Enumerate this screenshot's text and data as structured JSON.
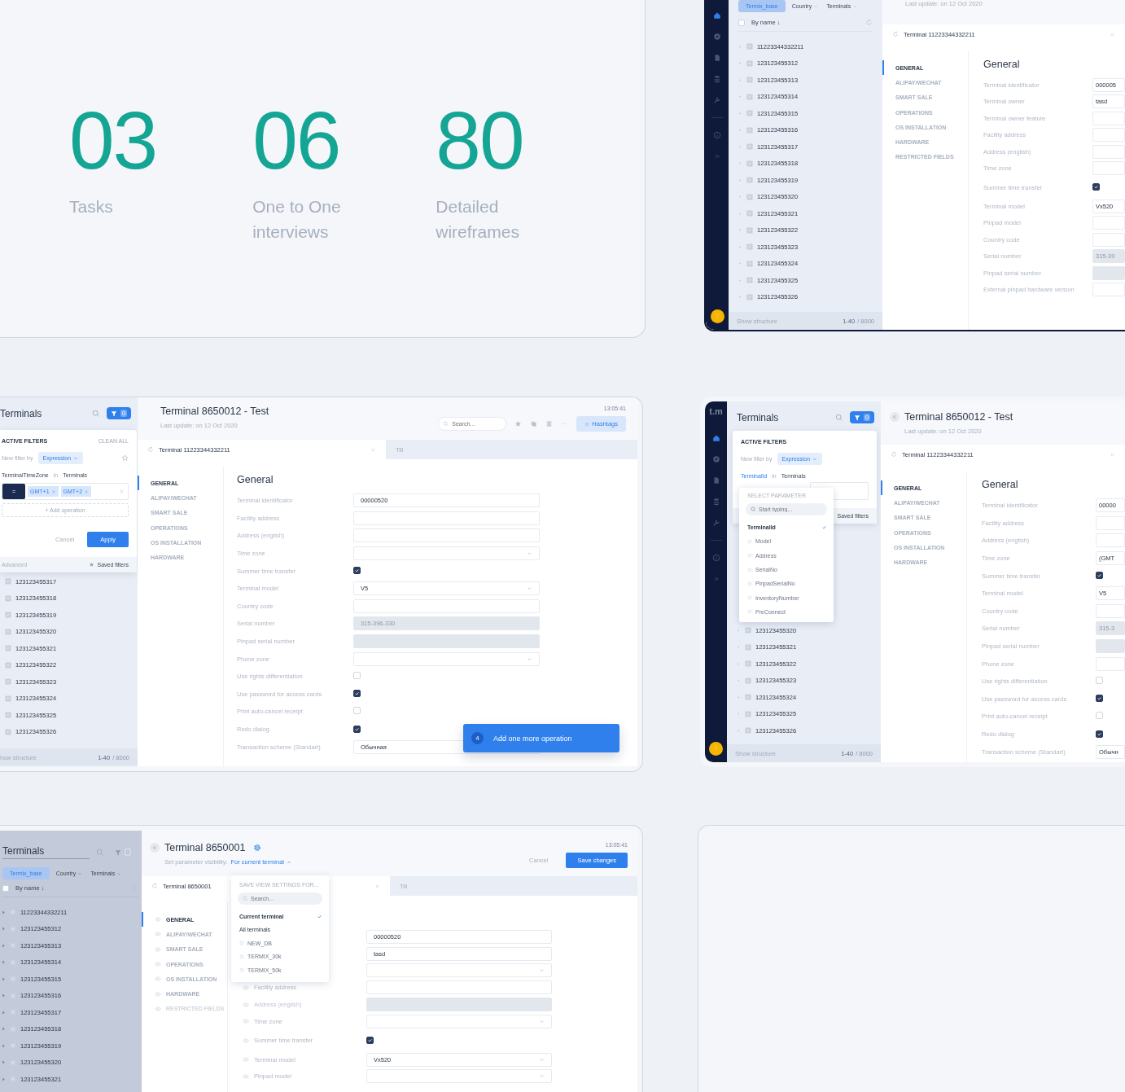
{
  "stats": [
    {
      "value": "03",
      "label": "Tasks"
    },
    {
      "value": "06",
      "label": "One to One interviews"
    },
    {
      "value": "80",
      "label": "Detailed wireframes"
    }
  ],
  "screens": [
    {
      "rail": {
        "avatar": "T"
      },
      "list": {
        "tags": [
          {
            "label": "Termix_base",
            "selected": true
          },
          {
            "label": "Country",
            "selected": false
          },
          {
            "label": "Terminals",
            "selected": false
          }
        ],
        "sort": "By name ↓",
        "expandable": true,
        "dimmed": false,
        "items": [
          "11223344332211",
          "123123455312",
          "123123455313",
          "123123455314",
          "123123455315",
          "123123455316",
          "123123455317",
          "123123455318",
          "123123455319",
          "123123455320",
          "123123455321",
          "123123455322",
          "123123455323",
          "123123455324",
          "123123455325",
          "123123455326"
        ],
        "footer": {
          "link": "Show structure",
          "range": "1-40",
          "total": "/ 8000"
        }
      },
      "detail": {
        "updated": "Last update: on 12 Oct 2020",
        "tabs": [
          {
            "label": "Terminal 11223344332211",
            "selected": true
          }
        ],
        "nav": [
          {
            "label": "GENERAL",
            "selected": true,
            "disabled": false
          },
          {
            "label": "ALIPAY/WECHAT",
            "selected": false,
            "disabled": false
          },
          {
            "label": "SMART SALE",
            "selected": false,
            "disabled": false
          },
          {
            "label": "OPERATIONS",
            "selected": false,
            "disabled": false
          },
          {
            "label": "OS INSTALLATION",
            "selected": false,
            "disabled": false
          },
          {
            "label": "HARDWARE",
            "selected": false,
            "disabled": false
          },
          {
            "label": "RESTRICTED FIELDS",
            "selected": false,
            "disabled": false
          }
        ],
        "section": "General",
        "fields": [
          {
            "label": "Terminal identificator",
            "kind": "text",
            "value": "000005",
            "disabled": false
          },
          {
            "label": "Terminal owner",
            "kind": "text",
            "value": "tasd",
            "disabled": false
          },
          {
            "label": "Terminal owner feature",
            "kind": "text",
            "disabled": false
          },
          {
            "label": "Facility address",
            "kind": "text",
            "disabled": false
          },
          {
            "label": "Address (english)",
            "kind": "text",
            "disabled": false
          },
          {
            "label": "Time zone",
            "kind": "text",
            "disabled": false
          },
          {
            "label": "Summer time transfer",
            "kind": "checkbox",
            "checked": true
          },
          {
            "label": "Terminal model",
            "kind": "text",
            "value": "Vx520",
            "disabled": false
          },
          {
            "label": "Pinpad model",
            "kind": "text",
            "disabled": false
          },
          {
            "label": "Country code",
            "kind": "text",
            "disabled": false
          },
          {
            "label": "Serial number",
            "kind": "text",
            "value": "315-39",
            "disabled": true
          },
          {
            "label": "Pinpad serial number",
            "kind": "text",
            "disabled": true
          },
          {
            "label": "External pinpad hardware version",
            "kind": "text",
            "disabled": false
          }
        ]
      }
    },
    {
      "list": {
        "title": "Terminals",
        "filter_count": "0",
        "filter_active": true,
        "expandable": false,
        "dimmed": false,
        "items": [
          "123123455317",
          "123123455318",
          "123123455319",
          "123123455320",
          "123123455321",
          "123123455322",
          "123123455323",
          "123123455324",
          "123123455325",
          "123123455326"
        ],
        "footer": {
          "link": "how structure",
          "range": "1-40",
          "total": "/ 8000"
        },
        "filter_popup": {
          "heading": "ACTIVE FILTERS",
          "clear": "CLEAN ALL",
          "new_filter_label": "New filter by",
          "new_filter_value": "Expression",
          "parameter": "TerminalTimeZone",
          "parameter_active": false,
          "in": "in",
          "scope": "Terminals",
          "operator": "=",
          "chips": [
            "GMT+1",
            "GMT+2"
          ],
          "add": "+ Add operation",
          "cancel": "Cancel",
          "apply": "Apply",
          "advanced": "Advanced",
          "saved": "Saved filters"
        }
      },
      "detail": {
        "title": "Terminal 8650012 - Test",
        "updated": "Last update: on 12 Oct 2020",
        "time": "13:05:41",
        "search_placeholder": "Search...",
        "hashtags": "Hashtags",
        "tabs": [
          {
            "label": "Terminal 11223344332211",
            "selected": true
          },
          {
            "label": "Till",
            "selected": false
          }
        ],
        "nav": [
          {
            "label": "GENERAL",
            "selected": true,
            "disabled": false
          },
          {
            "label": "ALIPAY/WECHAT",
            "selected": false,
            "disabled": false
          },
          {
            "label": "SMART SALE",
            "selected": false,
            "disabled": false
          },
          {
            "label": "OPERATIONS",
            "selected": false,
            "disabled": false
          },
          {
            "label": "OS INSTALLATION",
            "selected": false,
            "disabled": false
          },
          {
            "label": "HARDWARE",
            "selected": false,
            "disabled": false
          }
        ],
        "section": "General",
        "fields": [
          {
            "label": "Terminal identificator",
            "kind": "text",
            "value": "00000520",
            "disabled": false
          },
          {
            "label": "Facility address",
            "kind": "text",
            "disabled": false
          },
          {
            "label": "Address (english)",
            "kind": "text",
            "disabled": false
          },
          {
            "label": "Time zone",
            "kind": "select"
          },
          {
            "label": "Summer time transfer",
            "kind": "checkbox",
            "checked": true
          },
          {
            "label": "Terminal model",
            "kind": "select",
            "value": "V5"
          },
          {
            "label": "Country code",
            "kind": "text",
            "disabled": false
          },
          {
            "label": "Serial number",
            "kind": "text",
            "value": "315-396-330",
            "disabled": true
          },
          {
            "label": "Pinpad serial number",
            "kind": "text",
            "disabled": true
          },
          {
            "label": "Phone zone",
            "kind": "select"
          },
          {
            "label": "Use rights differentiation",
            "kind": "checkbox",
            "checked": false
          },
          {
            "label": "Use password for access cards",
            "kind": "checkbox",
            "checked": true
          },
          {
            "label": "Print auto-cancel receipt",
            "kind": "checkbox",
            "checked": false
          },
          {
            "label": "Redo dialog",
            "kind": "checkbox",
            "checked": true
          },
          {
            "label": "Transaction scheme (Standart)",
            "kind": "select",
            "value": "Обычная"
          }
        ],
        "toast": {
          "badge": "4",
          "text": "Add one more operation"
        }
      }
    },
    {
      "rail": {
        "logo": "t.m",
        "avatar": "T"
      },
      "list": {
        "title": "Terminals",
        "filter_count": "0",
        "filter_active": true,
        "expandable": true,
        "dimmed": false,
        "items": [
          "123123455320",
          "123123455321",
          "123123455322",
          "123123455323",
          "123123455324",
          "123123455325",
          "123123455326"
        ],
        "footer": {
          "link": "Show structure",
          "range": "1-40",
          "total": "/ 8000"
        },
        "filter_popup": {
          "heading": "ACTIVE FILTERS",
          "new_filter_label": "New filter by",
          "new_filter_value": "Expression",
          "parameter": "TerminalId",
          "parameter_active": true,
          "in": "in",
          "scope": "Terminals",
          "saved": "Saved filters",
          "dropdown": {
            "heading": "SELECT PARAMETER",
            "placeholder": "Start typing...",
            "options": [
              {
                "label": "TerminalId",
                "selected": true
              },
              {
                "label": "Model",
                "selected": false
              },
              {
                "label": "Address",
                "selected": false
              },
              {
                "label": "SerialNo",
                "selected": false
              },
              {
                "label": "PinpadSerialNo",
                "selected": false
              },
              {
                "label": "InventoryNumber",
                "selected": false
              },
              {
                "label": "PreConnect",
                "selected": false
              }
            ]
          }
        }
      },
      "detail": {
        "back": true,
        "title": "Terminal 8650012 - Test",
        "updated": "Last update: on 12 Oct 2020",
        "tabs": [
          {
            "label": "Terminal 11223344332211",
            "selected": true
          }
        ],
        "nav": [
          {
            "label": "GENERAL",
            "selected": true,
            "disabled": false
          },
          {
            "label": "ALIPAY/WECHAT",
            "selected": false,
            "disabled": false
          },
          {
            "label": "SMART SALE",
            "selected": false,
            "disabled": false
          },
          {
            "label": "OPERATIONS",
            "selected": false,
            "disabled": false
          },
          {
            "label": "OS INSTALLATION",
            "selected": false,
            "disabled": false
          },
          {
            "label": "HARDWARE",
            "selected": false,
            "disabled": false
          }
        ],
        "section": "General",
        "fields": [
          {
            "label": "Terminal identificator",
            "kind": "text",
            "value": "00000",
            "disabled": false
          },
          {
            "label": "Facility address",
            "kind": "text",
            "disabled": false
          },
          {
            "label": "Address (english)",
            "kind": "text",
            "disabled": false
          },
          {
            "label": "Time zone",
            "kind": "text",
            "value": "(GMT",
            "disabled": false
          },
          {
            "label": "Summer time transfer",
            "kind": "checkbox",
            "checked": true
          },
          {
            "label": "Terminal model",
            "kind": "text",
            "value": "V5",
            "disabled": false
          },
          {
            "label": "Country code",
            "kind": "text",
            "disabled": false
          },
          {
            "label": "Serial number",
            "kind": "text",
            "value": "315-3",
            "disabled": true
          },
          {
            "label": "Pinpad serial number",
            "kind": "text",
            "disabled": true
          },
          {
            "label": "Phone zone",
            "kind": "text",
            "disabled": false
          },
          {
            "label": "Use rights differentiation",
            "kind": "checkbox",
            "checked": false
          },
          {
            "label": "Use password for access cards",
            "kind": "checkbox",
            "checked": true
          },
          {
            "label": "Print auto-cancel receipt",
            "kind": "checkbox",
            "checked": false
          },
          {
            "label": "Redo dialog",
            "kind": "checkbox",
            "checked": true
          },
          {
            "label": "Transaction scheme (Standart)",
            "kind": "text",
            "value": "Обычн",
            "disabled": false
          }
        ]
      }
    },
    {
      "list": {
        "title": "Terminals",
        "filter_count": "0",
        "filter_active": false,
        "expandable": true,
        "dimmed": true,
        "tags": [
          {
            "label": "Termix_base",
            "selected": true
          },
          {
            "label": "Country",
            "selected": false
          },
          {
            "label": "Terminals",
            "selected": false
          }
        ],
        "sort": "By name ↓",
        "items": [
          "11223344332211",
          "123123455312",
          "123123455313",
          "123123455314",
          "123123455315",
          "123123455316",
          "123123455317",
          "123123455318",
          "123123455319",
          "123123455320",
          "123123455321"
        ]
      },
      "detail": {
        "back": true,
        "gear": true,
        "title": "Terminal 8650001",
        "visibility_label": "Set parameter visibility:",
        "visibility_value": "For current terminal",
        "time": "13:05:41",
        "cancel": "Cancel",
        "save": "Save changes",
        "eye_icons": true,
        "tabs": [
          {
            "label": "Terminal 8650001",
            "selected": true
          },
          {
            "label": "Till",
            "selected": false
          }
        ],
        "nav": [
          {
            "label": "GENERAL",
            "selected": true,
            "disabled": false
          },
          {
            "label": "ALIPAY/WECHAT",
            "selected": false,
            "disabled": false
          },
          {
            "label": "SMART SALE",
            "selected": false,
            "disabled": false
          },
          {
            "label": "OPERATIONS",
            "selected": false,
            "disabled": false
          },
          {
            "label": "OS INSTALLATION",
            "selected": false,
            "disabled": false
          },
          {
            "label": "HARDWARE",
            "selected": false,
            "disabled": false
          },
          {
            "label": "RESTRICTED FIELDS",
            "selected": false,
            "disabled": true
          }
        ],
        "fields": [
          {
            "kind": "text",
            "value": "00000520",
            "disabled": false
          },
          {
            "kind": "text",
            "value": "tasd",
            "disabled": false
          },
          {
            "kind": "select"
          },
          {
            "label": "Facility address",
            "kind": "text",
            "disabled": false
          },
          {
            "label": "Address (english)",
            "kind": "text",
            "disabled": true
          },
          {
            "label": "Time zone",
            "kind": "select"
          },
          {
            "label": "Summer time transfer",
            "kind": "checkbox",
            "checked": true
          },
          {
            "label": "Terminal model",
            "kind": "select",
            "value": "Vx520"
          },
          {
            "label": "Pinpad model",
            "kind": "select"
          }
        ],
        "visibility_menu": {
          "heading": "SAVE VIEW SETTINGS FOR...",
          "placeholder": "Search...",
          "options": [
            {
              "label": "Current terminal",
              "kind": "scope",
              "selected": true
            },
            {
              "label": "All terminals",
              "kind": "scope",
              "selected": false
            },
            {
              "label": "NEW_DB",
              "kind": "base",
              "selected": false
            },
            {
              "label": "TERMIX_30k",
              "kind": "base",
              "selected": false
            },
            {
              "label": "TERMIX_50k",
              "kind": "base",
              "selected": false
            }
          ]
        }
      }
    }
  ]
}
